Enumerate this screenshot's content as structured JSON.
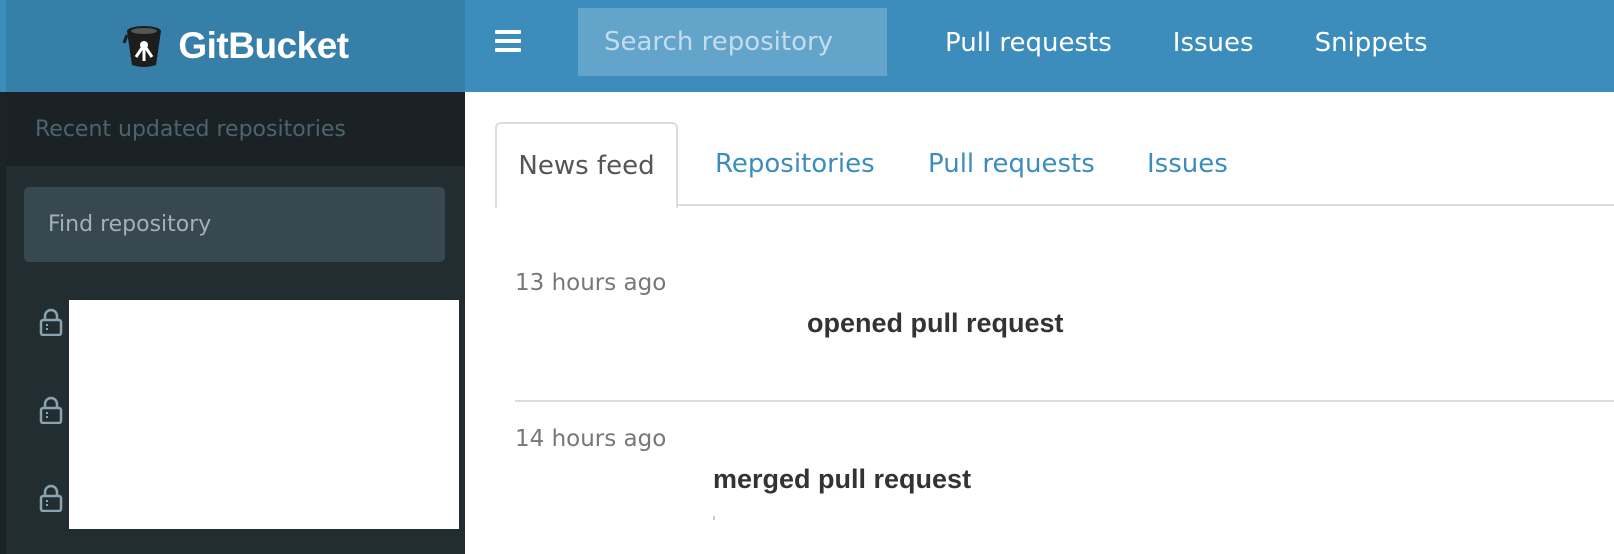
{
  "header": {
    "brand": "GitBucket",
    "search_placeholder": "Search repository",
    "nav": [
      "Pull requests",
      "Issues",
      "Snippets"
    ]
  },
  "sidebar": {
    "header": "Recent updated repositories",
    "find_placeholder": "Find repository",
    "repo_count": 3
  },
  "tabs": [
    "News feed",
    "Repositories",
    "Pull requests",
    "Issues"
  ],
  "feed": [
    {
      "time": "13 hours ago",
      "action": "opened pull request"
    },
    {
      "time": "14 hours ago",
      "action": "merged pull request"
    }
  ],
  "colors": {
    "navbar": "#3c8dbc",
    "brand_bar": "#367fa9",
    "sidebar": "#222d32",
    "link": "#3c8dbc"
  }
}
